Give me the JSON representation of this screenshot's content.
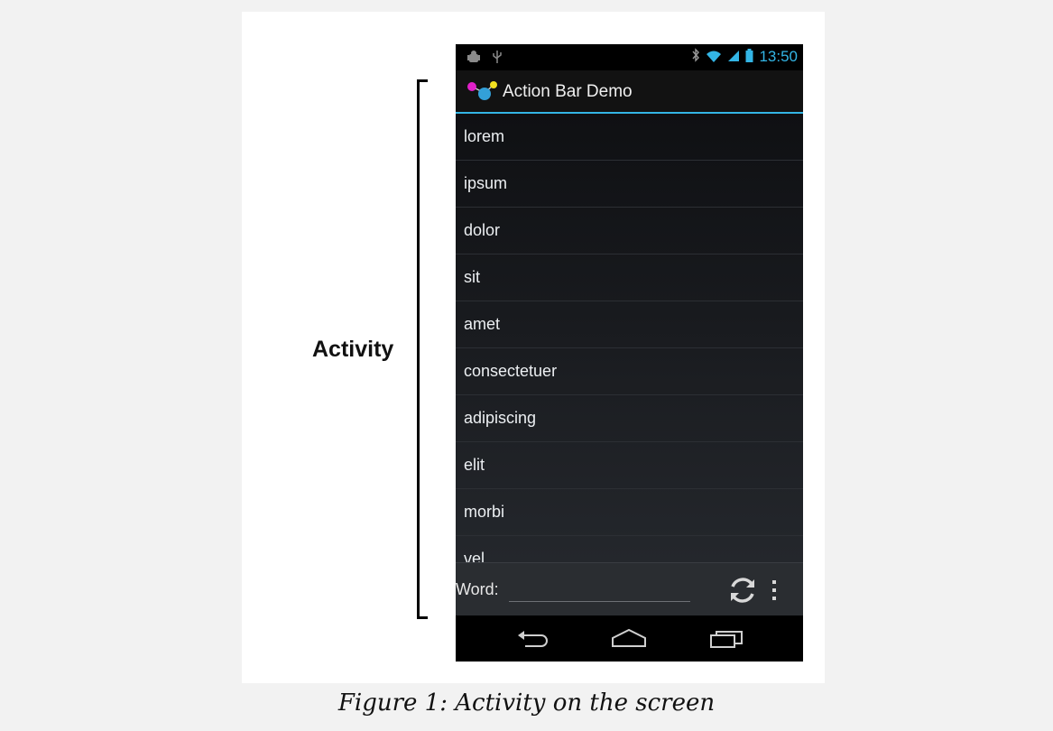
{
  "figure": {
    "bracket_label": "Activity",
    "caption": "Figure 1: Activity on the screen"
  },
  "status_bar": {
    "time": "13:50",
    "left_icons": [
      "android-debug-icon",
      "usb-icon"
    ],
    "right_icons": [
      "bluetooth-icon",
      "wifi-icon",
      "signal-icon",
      "battery-icon"
    ]
  },
  "action_bar": {
    "title": "Action Bar Demo",
    "icon": "app-molecule-icon"
  },
  "list": {
    "items": [
      "lorem",
      "ipsum",
      "dolor",
      "sit",
      "amet",
      "consectetuer",
      "adipiscing",
      "elit",
      "morbi",
      "vel"
    ]
  },
  "bottom_bar": {
    "word_label": "Word:",
    "word_value": "",
    "refresh_icon": "refresh-icon",
    "overflow_icon": "overflow-menu-icon"
  },
  "nav_bar": {
    "buttons": [
      "back-icon",
      "home-icon",
      "recent-apps-icon"
    ]
  },
  "colors": {
    "accent": "#33b5e5",
    "action_bar_bg": "#121212",
    "list_bg": "#1a1c20"
  }
}
